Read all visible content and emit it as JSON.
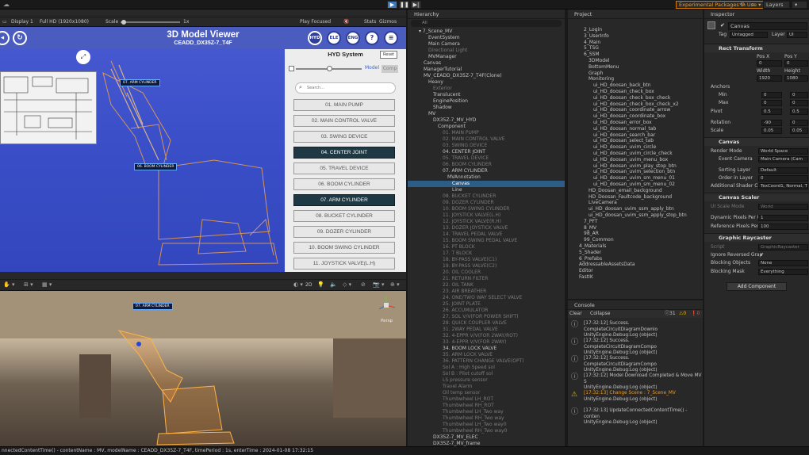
{
  "toolbar": {
    "play_icon": "play-icon",
    "pause_icon": "pause-icon",
    "step_icon": "step-icon",
    "experimental": "Experimental Packages In Use ▾",
    "layers": "Layers",
    "layout": "▾"
  },
  "game": {
    "display": "Display 1",
    "resolution": "Full HD (1920x1080)",
    "scale_label": "Scale",
    "scale_value": "1x",
    "play_focused": "Play Focused",
    "stats": "Stats",
    "gizmos": "Gizmos"
  },
  "app": {
    "title": "3D Model Viewer",
    "subtitle": "CEADD_DX35Z-7_T4F",
    "modes": [
      "HYD",
      "ELE",
      "ENG",
      "?",
      "≡"
    ],
    "panel_title": "HYD System",
    "reset": "Reset",
    "model": "Model",
    "comp": "Comp",
    "search": "Search...",
    "components": [
      {
        "label": "01. MAIN PUMP",
        "active": false
      },
      {
        "label": "02. MAIN CONTROL VALVE",
        "active": false
      },
      {
        "label": "03. SWING DEVICE",
        "active": false
      },
      {
        "label": "04. CENTER JOINT",
        "active": true
      },
      {
        "label": "05. TRAVEL DEVICE",
        "active": false
      },
      {
        "label": "06. BOOM CYLINDER",
        "active": false
      },
      {
        "label": "07. ARM CYLINDER",
        "active": true
      },
      {
        "label": "08. BUCKET CYLINDER",
        "active": false
      },
      {
        "label": "09. DOZER CYLINDER",
        "active": false
      },
      {
        "label": "10. BOOM SWING CYLINDER",
        "active": false
      },
      {
        "label": "11. JOYSTICK VALVE(L.H)",
        "active": false
      }
    ],
    "tag_arm": "07. ARM CYLINDER",
    "tag_boom": "06. BOOM CYLINDER"
  },
  "scene": {
    "mode_2d": "2D",
    "persp": "Persp"
  },
  "hierarchy": {
    "title": "Hierarchy",
    "search": "All",
    "rows": [
      {
        "t": "▾ 7_Scene_MV",
        "i": 0,
        "d": false
      },
      {
        "t": "EventSystem",
        "i": 2,
        "d": false
      },
      {
        "t": "Main Camera",
        "i": 2,
        "d": false
      },
      {
        "t": "Directional Light",
        "i": 2,
        "d": true
      },
      {
        "t": "MVManager",
        "i": 2,
        "d": false
      },
      {
        "t": "Canvas",
        "i": 1,
        "d": false
      },
      {
        "t": "ManagerTutorial",
        "i": 1,
        "d": false
      },
      {
        "t": "MV_CEADD_DX35Z-7_T4F(Clone)",
        "i": 1,
        "d": false
      },
      {
        "t": "Heavy",
        "i": 2,
        "d": false
      },
      {
        "t": "Exterior",
        "i": 3,
        "d": true
      },
      {
        "t": "Translucent",
        "i": 3,
        "d": false
      },
      {
        "t": "EnginePosition",
        "i": 3,
        "d": false
      },
      {
        "t": "Shadow",
        "i": 3,
        "d": false
      },
      {
        "t": "MV",
        "i": 2,
        "d": false
      },
      {
        "t": "DX35Z-7_MV_HYD",
        "i": 3,
        "d": false
      },
      {
        "t": "Component",
        "i": 4,
        "d": false
      },
      {
        "t": "01. MAIN PUMP",
        "i": 5,
        "d": true
      },
      {
        "t": "02. MAIN CONTROL VALVE",
        "i": 5,
        "d": true
      },
      {
        "t": "03. SWING DEVICE",
        "i": 5,
        "d": true
      },
      {
        "t": "04. CENTER JOINT",
        "i": 5,
        "d": false
      },
      {
        "t": "05. TRAVEL DEVICE",
        "i": 5,
        "d": true
      },
      {
        "t": "06. BOOM CYLINDER",
        "i": 5,
        "d": true
      },
      {
        "t": "07. ARM CYLINDER",
        "i": 5,
        "d": false
      },
      {
        "t": "MVAnnotation",
        "i": 6,
        "d": false
      },
      {
        "t": "Canvas",
        "i": 7,
        "d": false,
        "sel": true
      },
      {
        "t": "Line",
        "i": 7,
        "d": false
      },
      {
        "t": "08. BUCKET CYLINDER",
        "i": 5,
        "d": true
      },
      {
        "t": "09. DOZER CYLINDER",
        "i": 5,
        "d": true
      },
      {
        "t": "10. BOOM SWING CYLINDER",
        "i": 5,
        "d": true
      },
      {
        "t": "11. JOYSTICK VALVE(L.H)",
        "i": 5,
        "d": true
      },
      {
        "t": "12. JOYSTICK VALVE(R.H)",
        "i": 5,
        "d": true
      },
      {
        "t": "13. DOZER JOYSTICK VALVE",
        "i": 5,
        "d": true
      },
      {
        "t": "14. TRAVEL PEDAL VALVE",
        "i": 5,
        "d": true
      },
      {
        "t": "15. BOOM SWING PEDAL VALVE",
        "i": 5,
        "d": true
      },
      {
        "t": "16. PT BLOCK",
        "i": 5,
        "d": true
      },
      {
        "t": "17. T BLOCK",
        "i": 5,
        "d": true
      },
      {
        "t": "18. BY-PASS VALVE(C1)",
        "i": 5,
        "d": true
      },
      {
        "t": "19. BY-PASS VALVE(C2)",
        "i": 5,
        "d": true
      },
      {
        "t": "20. OIL COOLER",
        "i": 5,
        "d": true
      },
      {
        "t": "21. RETURN FILTER",
        "i": 5,
        "d": true
      },
      {
        "t": "22. OIL TANK",
        "i": 5,
        "d": true
      },
      {
        "t": "23. AIR BREATHER",
        "i": 5,
        "d": true
      },
      {
        "t": "24. ONE/TWO WAY SELECT VALVE",
        "i": 5,
        "d": true
      },
      {
        "t": "25. JOINT PLATE",
        "i": 5,
        "d": true
      },
      {
        "t": "26. ACCUMULATOR",
        "i": 5,
        "d": true
      },
      {
        "t": "27. SOL V/V(FOR POWER SHIFT)",
        "i": 5,
        "d": true
      },
      {
        "t": "28. QUICK COUPLER VALVE",
        "i": 5,
        "d": true
      },
      {
        "t": "31. 2WAY PEDAL VALVE",
        "i": 5,
        "d": true
      },
      {
        "t": "32. 4-EPPR V/V(FOR 2WAY/ROT)",
        "i": 5,
        "d": true
      },
      {
        "t": "33. 4-EPPR V/V(FOR 2WAY)",
        "i": 5,
        "d": true
      },
      {
        "t": "34. BOOM LOCK VALVE",
        "i": 5,
        "d": false
      },
      {
        "t": "35. ARM LOCK VALVE",
        "i": 5,
        "d": true
      },
      {
        "t": "36. PATTERN CHANGE VALVE(OPT)",
        "i": 5,
        "d": true
      },
      {
        "t": "Sol A : High Speed sol",
        "i": 5,
        "d": true
      },
      {
        "t": "Sol B : Pilot cutoff sol",
        "i": 5,
        "d": true
      },
      {
        "t": "LS pressure sensor",
        "i": 5,
        "d": true
      },
      {
        "t": "Travel Alarm",
        "i": 5,
        "d": true
      },
      {
        "t": "Oil temp sensor",
        "i": 5,
        "d": true
      },
      {
        "t": "Thumbwheel LH_ROT",
        "i": 5,
        "d": true
      },
      {
        "t": "Thumbwheel RH_ROT",
        "i": 5,
        "d": true
      },
      {
        "t": "Thumbwheel LH_Two way",
        "i": 5,
        "d": true
      },
      {
        "t": "Thumbwheel RH_Two way",
        "i": 5,
        "d": true
      },
      {
        "t": "Thumbwheel LH_Two way0",
        "i": 5,
        "d": true
      },
      {
        "t": "Thumbwheel RH_Two way0",
        "i": 5,
        "d": true
      },
      {
        "t": "DX35Z-7_MV_ELEC",
        "i": 3,
        "d": false
      },
      {
        "t": "DX35Z-7_MV_frame",
        "i": 3,
        "d": false
      }
    ]
  },
  "project": {
    "title": "Project",
    "rows": [
      {
        "t": "2_Login",
        "i": 2
      },
      {
        "t": "3_UserInfo",
        "i": 2
      },
      {
        "t": "4_Main",
        "i": 2
      },
      {
        "t": "5_TSG",
        "i": 2
      },
      {
        "t": "6_SSM",
        "i": 2
      },
      {
        "t": "3DModel",
        "i": 3
      },
      {
        "t": "BottomMenu",
        "i": 3
      },
      {
        "t": "Graph",
        "i": 3
      },
      {
        "t": "Monitoring",
        "i": 3
      },
      {
        "t": "ui_HD_doosan_back_btn",
        "i": 4
      },
      {
        "t": "ui_HD_doosan_check_box",
        "i": 4
      },
      {
        "t": "ui_HD_doosan_check_box_check",
        "i": 4
      },
      {
        "t": "ui_HD_doosan_check_box_check_x2",
        "i": 4
      },
      {
        "t": "ui_HD_doosan_coordinate_arrow",
        "i": 4
      },
      {
        "t": "ui_HD_doosan_coordinate_box",
        "i": 4
      },
      {
        "t": "ui_HD_doosan_error_box",
        "i": 4
      },
      {
        "t": "ui_HD_doosan_normal_tab",
        "i": 4
      },
      {
        "t": "ui_HD_doosan_search_bar",
        "i": 4
      },
      {
        "t": "ui_HD_doosan_select_tab",
        "i": 4
      },
      {
        "t": "ui_HD_doosan_uvim_circle",
        "i": 4
      },
      {
        "t": "ui_HD_doosan_uvim_circle_check",
        "i": 4
      },
      {
        "t": "ui_HD_doosan_uvim_menu_box",
        "i": 4
      },
      {
        "t": "ui_HD_doosan_uvim_play_stop_btn",
        "i": 4
      },
      {
        "t": "ui_HD_doosan_uvim_selection_btn",
        "i": 4
      },
      {
        "t": "ui_HD_doosan_uvim_sm_menu_01",
        "i": 4
      },
      {
        "t": "ui_HD_doosan_uvim_sm_menu_02",
        "i": 4
      },
      {
        "t": "HD_Doosan_email_background",
        "i": 3
      },
      {
        "t": "HD_Doosan_Faultcode_background",
        "i": 3
      },
      {
        "t": "LiveCamera",
        "i": 3
      },
      {
        "t": "ui_HD_doosan_uvim_ssm_apply_btn",
        "i": 3
      },
      {
        "t": "ui_HD_doosan_uvim_ssm_apply_stop_btn",
        "i": 3
      },
      {
        "t": "7_PFT",
        "i": 2
      },
      {
        "t": "8_MV",
        "i": 2
      },
      {
        "t": "98_AR",
        "i": 2
      },
      {
        "t": "99_Common",
        "i": 2
      },
      {
        "t": "4_Materials",
        "i": 1
      },
      {
        "t": "5_Shader",
        "i": 1
      },
      {
        "t": "6_Prefabs",
        "i": 1
      },
      {
        "t": "AddressableAssetsData",
        "i": 1
      },
      {
        "t": "Editor",
        "i": 1
      },
      {
        "t": "FastIK",
        "i": 1
      }
    ]
  },
  "console": {
    "title": "Console",
    "clear": "Clear",
    "collapse": "Collapse",
    "count_log": "31",
    "count_warn": "0",
    "count_err": "0",
    "logs": [
      {
        "a": "[17:32:12] Success. CompleteCircuitDiagramDownlo",
        "b": "UnityEngine.Debug:Log (object)",
        "w": false
      },
      {
        "a": "[17:32:12] Success. CompleteCircuitDiagramCompo",
        "b": "UnityEngine.Debug:Log (object)",
        "w": false
      },
      {
        "a": "[17:32:12] Success. CompleteCircuitDiagramCompo",
        "b": "UnityEngine.Debug:Log (object)",
        "w": false
      },
      {
        "a": "[17:32:12] Model Download Completed & Move MV S",
        "b": "UnityEngine.Debug:Log (object)",
        "w": false
      },
      {
        "a": "[17:32:13] Change Scene : 7_Scene_MV",
        "b": "UnityEngine.Debug:Log (object)",
        "w": true
      },
      {
        "a": "[17:32:13] UpdateConnectedContentTime() - conten",
        "b": "UnityEngine.Debug:Log (object)",
        "w": false
      }
    ]
  },
  "inspector": {
    "title": "Inspector",
    "name": "Canvas",
    "tag_label": "Tag",
    "tag": "Untagged",
    "layer_label": "Layer",
    "layer": "UI",
    "rect": "Rect Transform",
    "pos_x_label": "Pos X",
    "pos_y_label": "Pos Y",
    "pos_x": "0",
    "pos_y": "0",
    "width_label": "Width",
    "height_label": "Height",
    "width": "1920",
    "height": "1080",
    "anchors": "Anchors",
    "min": "Min",
    "max": "Max",
    "pivot": "Pivot",
    "rotation": "Rotation",
    "scale": "Scale",
    "min_x": "0",
    "min_y": "0",
    "max_x": "0",
    "max_y": "0",
    "piv_x": "0.5",
    "piv_y": "0.5",
    "rot_x": "-90",
    "rot_y": "0",
    "sc_x": "0.05",
    "sc_y": "0.05",
    "canvas": "Canvas",
    "render_mode_label": "Render Mode",
    "render_mode": "World Space",
    "event_camera_label": "Event Camera",
    "event_camera": "Main Camera (Cam",
    "sorting_label": "Sorting Layer",
    "sorting": "Default",
    "order_label": "Order in Layer",
    "order": "0",
    "shader_label": "Additional Shader Ch",
    "shader": "TexCoord1, Normal, T",
    "scaler": "Canvas Scaler",
    "ui_scale_label": "UI Scale Mode",
    "ui_scale": "World",
    "dyn_label": "Dynamic Pixels Per U",
    "dyn": "1",
    "ref_label": "Reference Pixels Per",
    "ref": "100",
    "raycaster": "Graphic Raycaster",
    "script_label": "Script",
    "script": "GraphicRaycaster",
    "ignore_label": "Ignore Reversed Grap",
    "block_obj_label": "Blocking Objects",
    "block_obj": "None",
    "block_mask_label": "Blocking Mask",
    "block_mask": "Everything",
    "add_component": "Add Component"
  },
  "status": "nnectedContentTime() - contentName : MV, modelName : CEADD_DX35Z-7_T4F, timePeriod : 1s, enterTime : 2024-01-08 17:32:15"
}
